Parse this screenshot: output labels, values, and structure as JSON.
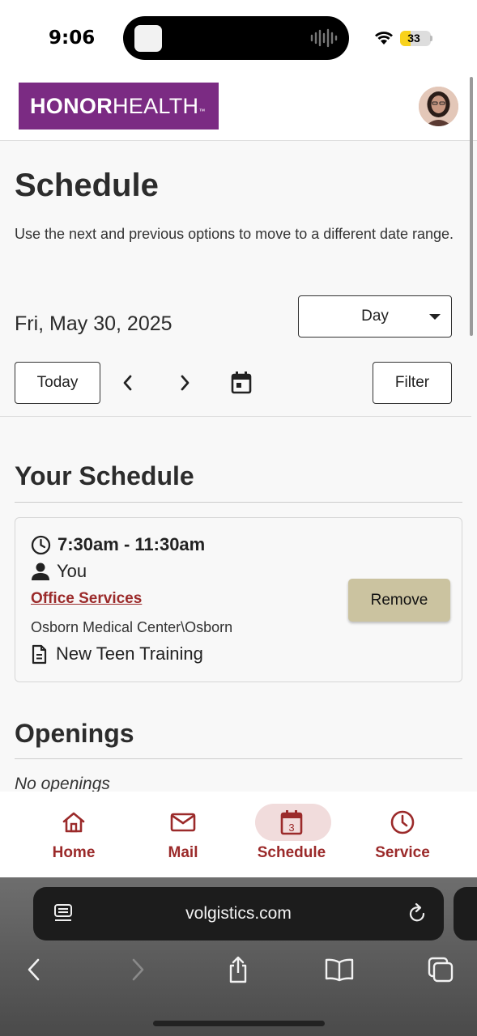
{
  "status_bar": {
    "time": "9:06",
    "battery": "33"
  },
  "header": {
    "logo_bold": "HONOR",
    "logo_light": "HEALTH",
    "logo_tm": "™",
    "avatar_icon": "user-avatar-photo"
  },
  "schedule": {
    "title": "Schedule",
    "intro": "Use the next and previous options to move to a different date range.",
    "date": "Fri, May 30, 2025",
    "view_select": "Day",
    "today_label": "Today",
    "filter_label": "Filter",
    "prev_icon": "chevron-left-icon",
    "next_icon": "chevron-right-icon",
    "calendar_icon": "calendar-icon"
  },
  "your_schedule": {
    "title": "Your Schedule",
    "entry": {
      "time": "7:30am - 11:30am",
      "person": "You",
      "service": "Office Services",
      "location": "Osborn Medical Center\\Osborn",
      "note": "New Teen Training",
      "remove_label": "Remove"
    }
  },
  "openings": {
    "title": "Openings",
    "empty_text": "No openings"
  },
  "bottom_nav": {
    "tabs": [
      {
        "label": "Home",
        "icon": "home-icon"
      },
      {
        "label": "Mail",
        "icon": "mail-icon"
      },
      {
        "label": "Schedule",
        "icon": "calendar-icon",
        "badge": "3",
        "active": true
      },
      {
        "label": "Service",
        "icon": "clock-icon"
      }
    ]
  },
  "browser": {
    "url": "volgistics.com"
  },
  "colors": {
    "brand_purple": "#7b2b83",
    "accent_red": "#9b2a2a",
    "remove_button": "#cbc3a0"
  }
}
